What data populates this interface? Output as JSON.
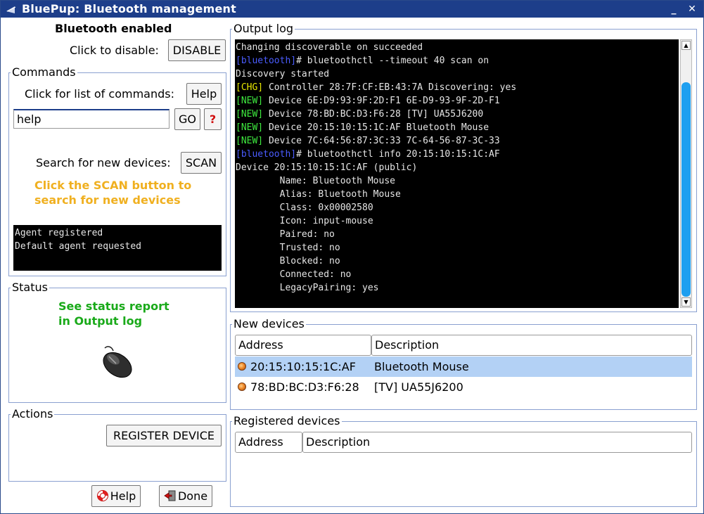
{
  "window": {
    "title": "BluePup: Bluetooth management"
  },
  "header": {
    "status_label": "Bluetooth enabled",
    "disable_prompt": "Click to disable:",
    "disable_button": "DISABLE"
  },
  "commands": {
    "legend": "Commands",
    "list_prompt": "Click for list of commands:",
    "help_button": "Help",
    "input_value": "help",
    "go_button": "GO",
    "question_button": "?",
    "scan_prompt": "Search for new devices:",
    "scan_button": "SCAN",
    "hint_line1": "Click the SCAN button to",
    "hint_line2": "search for new devices",
    "agent_log": [
      "Agent registered",
      "Default agent requested"
    ]
  },
  "status": {
    "legend": "Status",
    "message_line1": "See status report",
    "message_line2": "in Output log",
    "icon": "mouse-icon"
  },
  "actions": {
    "legend": "Actions",
    "register_button": "REGISTER DEVICE"
  },
  "footer": {
    "help_button": "Help",
    "done_button": "Done"
  },
  "output_log": {
    "legend": "Output log",
    "lines": [
      {
        "prefix": "",
        "text": "Changing discoverable on succeeded"
      },
      {
        "prefix": "[bluetooth]",
        "text": "# bluetoothctl --timeout 40 scan on"
      },
      {
        "prefix": "",
        "text": "Discovery started"
      },
      {
        "prefix": "[CHG]",
        "text": " Controller 28:7F:CF:EB:43:7A Discovering: yes"
      },
      {
        "prefix": "[NEW]",
        "text": " Device 6E:D9:93:9F:2D:F1 6E-D9-93-9F-2D-F1"
      },
      {
        "prefix": "[NEW]",
        "text": " Device 78:BD:BC:D3:F6:28 [TV] UA55J6200"
      },
      {
        "prefix": "[NEW]",
        "text": " Device 20:15:10:15:1C:AF Bluetooth Mouse"
      },
      {
        "prefix": "[NEW]",
        "text": " Device 7C:64:56:87:3C:33 7C-64-56-87-3C-33"
      },
      {
        "prefix": "[bluetooth]",
        "text": "# bluetoothctl info 20:15:10:15:1C:AF"
      },
      {
        "prefix": "",
        "text": "Device 20:15:10:15:1C:AF (public)"
      },
      {
        "prefix": "",
        "text": "        Name: Bluetooth Mouse"
      },
      {
        "prefix": "",
        "text": "        Alias: Bluetooth Mouse"
      },
      {
        "prefix": "",
        "text": "        Class: 0x00002580"
      },
      {
        "prefix": "",
        "text": "        Icon: input-mouse"
      },
      {
        "prefix": "",
        "text": "        Paired: no"
      },
      {
        "prefix": "",
        "text": "        Trusted: no"
      },
      {
        "prefix": "",
        "text": "        Blocked: no"
      },
      {
        "prefix": "",
        "text": "        Connected: no"
      },
      {
        "prefix": "",
        "text": "        LegacyPairing: yes"
      }
    ]
  },
  "new_devices": {
    "legend": "New devices",
    "columns": [
      "Address",
      "Description"
    ],
    "rows": [
      {
        "address": "20:15:10:15:1C:AF",
        "description": "Bluetooth Mouse",
        "selected": true
      },
      {
        "address": "78:BD:BC:D3:F6:28",
        "description": "[TV] UA55J6200",
        "selected": false
      }
    ]
  },
  "registered_devices": {
    "legend": "Registered devices",
    "columns": [
      "Address",
      "Description"
    ]
  },
  "colors": {
    "titlebar": "#1d3e8a",
    "hint_orange": "#f0b020",
    "status_green": "#1aaa1a",
    "selected_row": "#b3d1f5",
    "scrollbar_thumb": "#1e9ff0",
    "prefix_bluetooth": "#4a5cff",
    "prefix_chg": "#e6e600",
    "prefix_new": "#3ee83e"
  }
}
